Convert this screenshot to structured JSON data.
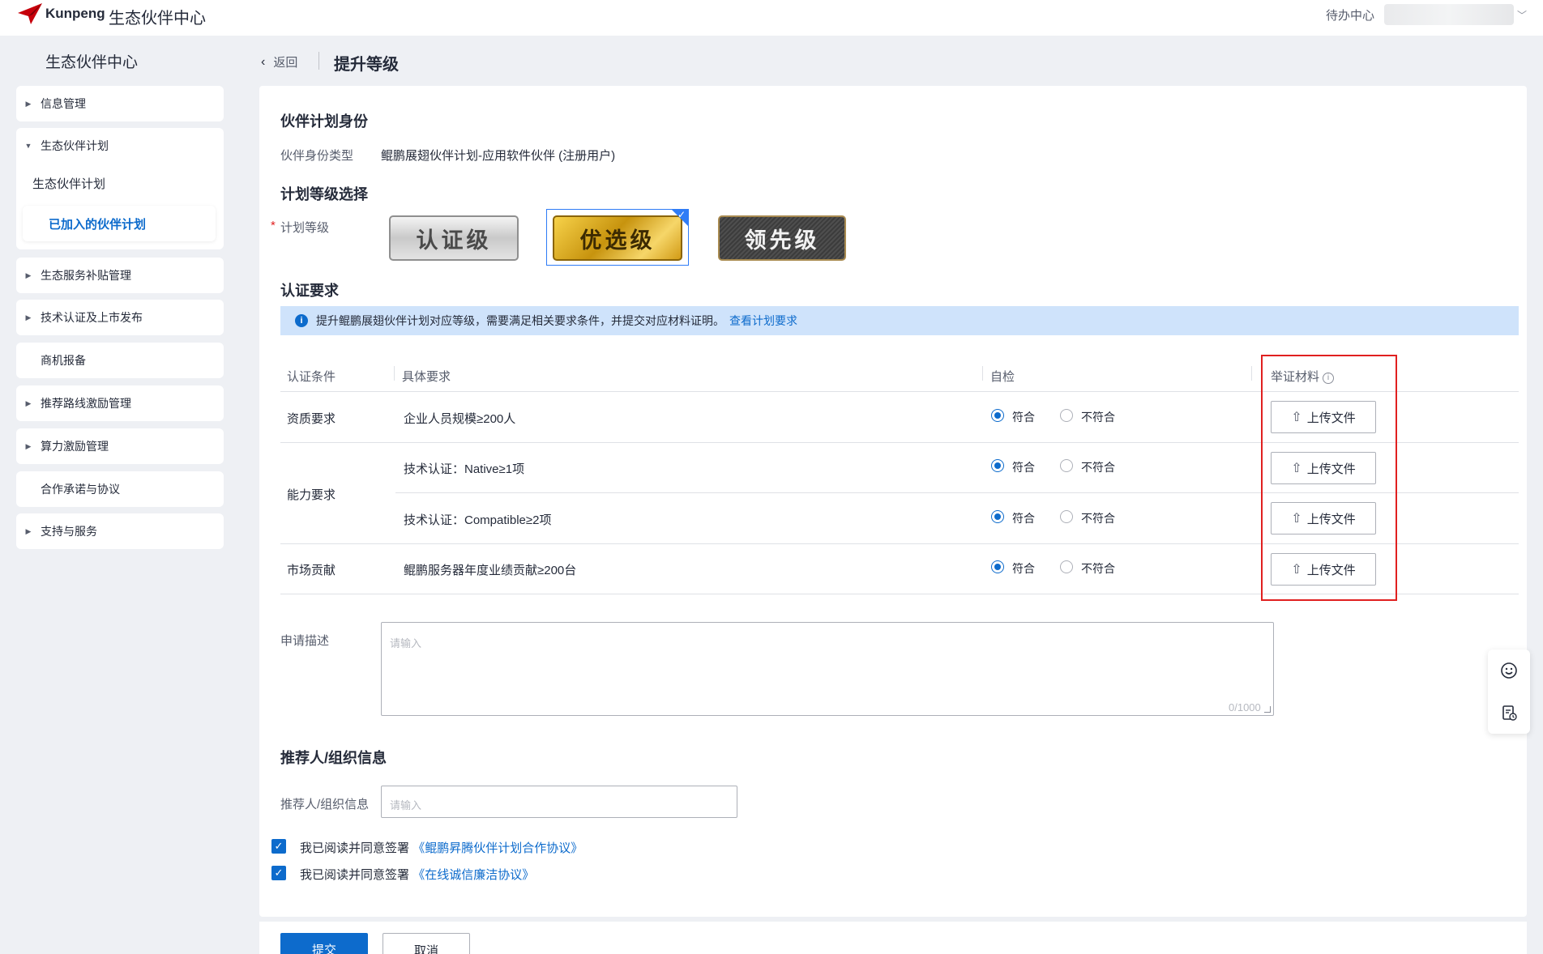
{
  "topbar": {
    "logo_text": "Kunpeng",
    "title": "生态伙伴中心",
    "todo": "待办中心",
    "user_caret": "﹀"
  },
  "sidebar": {
    "title": "生态伙伴中心",
    "items": [
      {
        "label": "信息管理"
      },
      {
        "label": "生态伙伴计划"
      },
      {
        "label": "生态伙伴计划"
      },
      {
        "label": "已加入的伙伴计划"
      },
      {
        "label": "生态服务补贴管理"
      },
      {
        "label": "技术认证及上市发布"
      },
      {
        "label": "商机报备"
      },
      {
        "label": "推荐路线激励管理"
      },
      {
        "label": "算力激励管理"
      },
      {
        "label": "合作承诺与协议"
      },
      {
        "label": "支持与服务"
      }
    ]
  },
  "header": {
    "back_label": "返回",
    "page_title": "提升等级"
  },
  "identity": {
    "section_title": "伙伴计划身份",
    "type_label": "伙伴身份类型",
    "type_value": "鲲鹏展翅伙伴计划-应用软件伙伴 (注册用户)"
  },
  "level": {
    "section_title": "计划等级选择",
    "required_mark": "*",
    "label": "计划等级",
    "options": [
      "认证级",
      "优选级",
      "领先级"
    ],
    "selected": "优选级"
  },
  "requirements": {
    "section_title": "认证要求",
    "info_text": "提升鲲鹏展翅伙伴计划对应等级，需要满足相关要求条件，并提交对应材料证明。",
    "info_link": "查看计划要求",
    "columns": [
      "认证条件",
      "具体要求",
      "自检",
      "举证材料"
    ],
    "groups": [
      "资质要求",
      "能力要求",
      "市场贡献"
    ],
    "rows": [
      {
        "requirement": "企业人员规模≥200人",
        "pass": "符合",
        "fail": "不符合",
        "upload": "上传文件"
      },
      {
        "requirement": "技术认证：Native≥1项",
        "pass": "符合",
        "fail": "不符合",
        "upload": "上传文件"
      },
      {
        "requirement": "技术认证：Compatible≥2项",
        "pass": "符合",
        "fail": "不符合",
        "upload": "上传文件"
      },
      {
        "requirement": "鲲鹏服务器年度业绩贡献≥200台",
        "pass": "符合",
        "fail": "不符合",
        "upload": "上传文件"
      }
    ]
  },
  "application": {
    "label": "申请描述",
    "placeholder": "请输入",
    "counter": "0/1000"
  },
  "referrer": {
    "section_title": "推荐人/组织信息",
    "label": "推荐人/组织信息",
    "placeholder": "请输入"
  },
  "agreements": [
    {
      "prefix": "我已阅读并同意签署",
      "link": "《鲲鹏昇腾伙伴计划合作协议》"
    },
    {
      "prefix": "我已阅读并同意签署",
      "link": "《在线诚信廉洁协议》"
    }
  ],
  "actions": {
    "submit": "提交",
    "cancel": "取消"
  },
  "colors": {
    "primary": "#0d6bcc",
    "highlight": "#e02020",
    "info_bg": "#cfe3fb"
  }
}
